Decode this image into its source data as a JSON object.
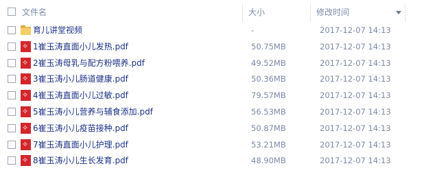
{
  "header": {
    "name_label": "文件名",
    "size_label": "大小",
    "modified_label": "修改时间"
  },
  "files": [
    {
      "name": "育儿讲堂视频",
      "size": "-",
      "modified": "2017-12-07 14:13",
      "type": "folder",
      "icon": "folder-icon"
    },
    {
      "name": "1崔玉涛直面小儿发热.pdf",
      "size": "50.75MB",
      "modified": "2017-12-07 14:13",
      "type": "pdf",
      "icon": "pdf-icon"
    },
    {
      "name": "2崔玉涛母乳与配方粉喂养.pdf",
      "size": "49.52MB",
      "modified": "2017-12-07 14:13",
      "type": "pdf",
      "icon": "pdf-icon"
    },
    {
      "name": "3崔玉涛小儿肠道健康.pdf",
      "size": "50.36MB",
      "modified": "2017-12-07 14:13",
      "type": "pdf",
      "icon": "pdf-icon"
    },
    {
      "name": "4崔玉涛直面小儿过敏.pdf",
      "size": "79.57MB",
      "modified": "2017-12-07 14:13",
      "type": "pdf",
      "icon": "pdf-icon"
    },
    {
      "name": "5崔玉涛小儿营养与辅食添加.pdf",
      "size": "56.53MB",
      "modified": "2017-12-07 14:13",
      "type": "pdf",
      "icon": "pdf-icon"
    },
    {
      "name": "6崔玉涛小儿疫苗接种.pdf",
      "size": "50.87MB",
      "modified": "2017-12-07 14:13",
      "type": "pdf",
      "icon": "pdf-icon"
    },
    {
      "name": "7崔玉涛直面小儿护理.pdf",
      "size": "53.21MB",
      "modified": "2017-12-07 14:13",
      "type": "pdf",
      "icon": "pdf-icon"
    },
    {
      "name": "8崔玉涛小儿生长发育.pdf",
      "size": "48.90MB",
      "modified": "2017-12-07 14:13",
      "type": "pdf",
      "icon": "pdf-icon"
    }
  ],
  "colors": {
    "text": "#1e3287",
    "meta": "#7b89a6",
    "pdf_red": "#d2262c",
    "folder": "#f5cd68"
  }
}
